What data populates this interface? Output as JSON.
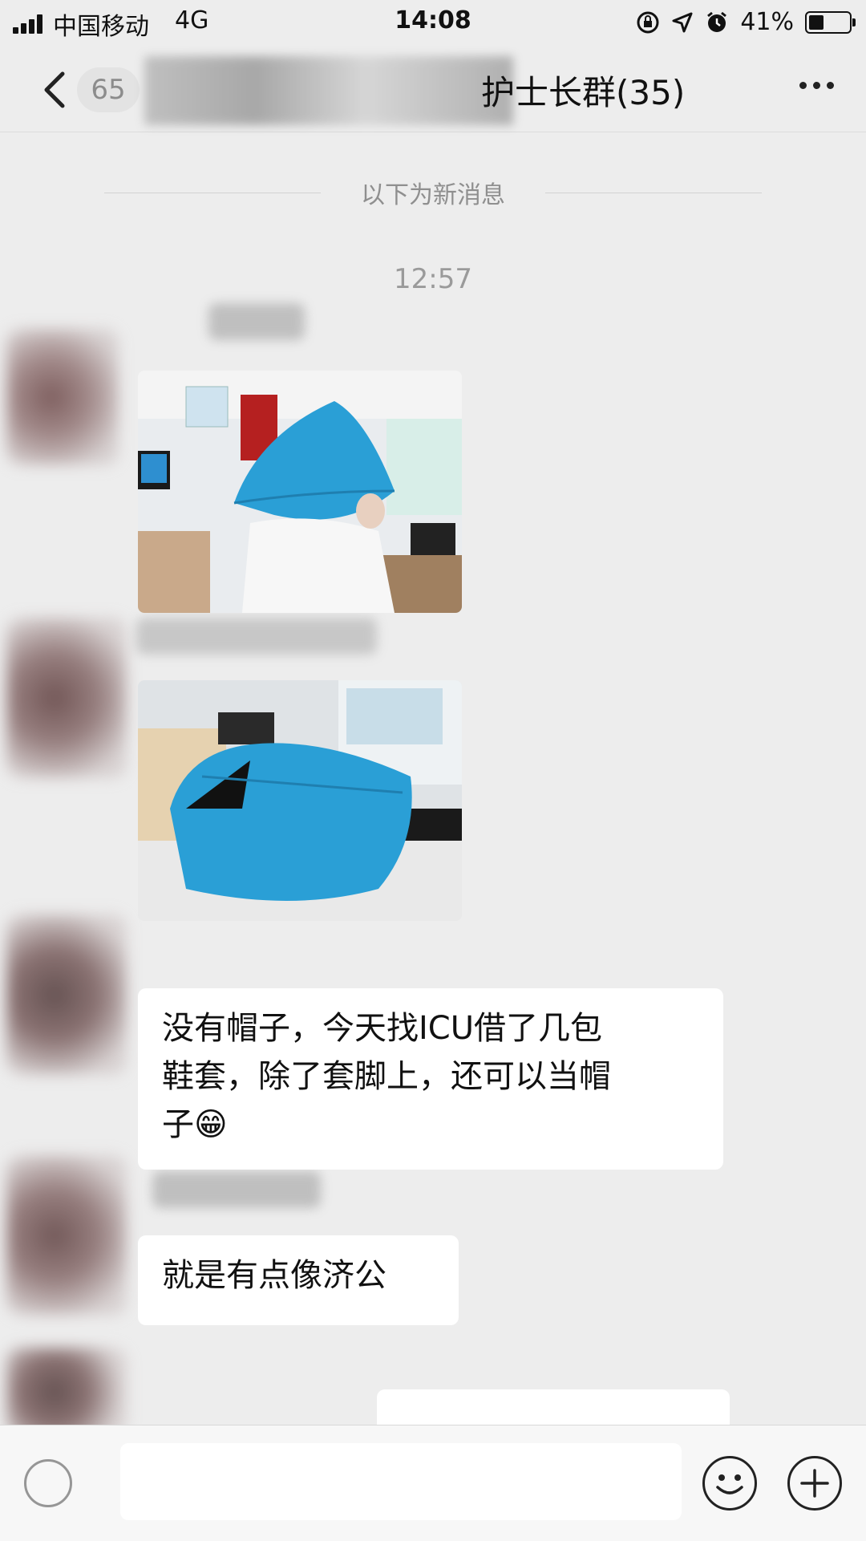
{
  "status_bar": {
    "carrier": "中国移动",
    "network": "4G",
    "time": "14:08",
    "battery_percent": "41%",
    "battery_level": 0.41
  },
  "nav": {
    "unread_count": "65",
    "title": "护士长群(35)"
  },
  "chat": {
    "divider_text": "以下为新消息",
    "timestamp": "12:57",
    "messages": [
      {
        "type": "image",
        "description_icon": "photo-icon"
      },
      {
        "type": "image",
        "description_icon": "photo-icon"
      },
      {
        "type": "text",
        "lines": [
          "没有帽子，今天找ICU借了几包",
          "鞋套，除了套脚上，还可以当帽",
          "子😁"
        ]
      },
      {
        "type": "text",
        "lines": [
          "就是有点像济公"
        ]
      },
      {
        "type": "text",
        "lines": [
          "…"
        ]
      }
    ]
  },
  "input_bar": {
    "voice_icon": "voice-icon",
    "emoji_icon": "emoji-icon",
    "plus_icon": "plus-icon"
  },
  "colors": {
    "background": "#ededed",
    "bubble": "#ffffff",
    "cap_blue": "#2a9fd6"
  }
}
